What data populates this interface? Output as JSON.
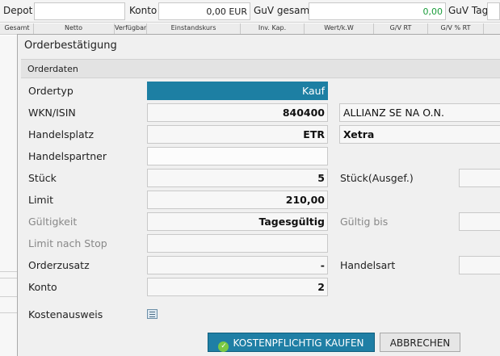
{
  "topbar": {
    "depot_label": "Depot",
    "konto_label": "Konto",
    "konto_value": "0,00 EUR",
    "guv_gesamt_label": "GuV gesamt",
    "guv_gesamt_value": "0,00",
    "guv_tag_label": "GuV Tag"
  },
  "columns": [
    "Gesamt",
    "Netto",
    "Verfügbar",
    "Einstandskurs",
    "Inv. Kap.",
    "Wert/k.W",
    "G/V RT",
    "G/V % RT"
  ],
  "dialog": {
    "title": "Orderbestätigung",
    "section": "Orderdaten",
    "fields": {
      "ordertyp": {
        "label": "Ordertyp",
        "value": "Kauf"
      },
      "wkn": {
        "label": "WKN/ISIN",
        "value": "840400",
        "name": "ALLIANZ SE NA O.N."
      },
      "handelsplatz": {
        "label": "Handelsplatz",
        "value": "ETR",
        "name": "Xetra"
      },
      "handelspartner": {
        "label": "Handelspartner",
        "value": ""
      },
      "stueck": {
        "label": "Stück",
        "value": "5",
        "ausgef_label": "Stück(Ausgef.)"
      },
      "limit": {
        "label": "Limit",
        "value": "210,00"
      },
      "gueltigkeit": {
        "label": "Gültigkeit",
        "value": "Tagesgültig",
        "bis_label": "Gültig bis"
      },
      "limit_stop": {
        "label": "Limit nach Stop",
        "value": ""
      },
      "orderzusatz": {
        "label": "Orderzusatz",
        "value": "-",
        "handelsart_label": "Handelsart"
      },
      "konto": {
        "label": "Konto",
        "value": "2"
      },
      "kostenausweis": {
        "label": "Kostenausweis"
      }
    },
    "buttons": {
      "buy": "KOSTENPFLICHTIG KAUFEN",
      "cancel": "ABBRECHEN"
    }
  },
  "icons": {
    "check": "check-circle-icon",
    "calculator": "calculator-icon"
  },
  "colors": {
    "accent": "#1f7fa5",
    "guv_value": "#1a9c3a"
  }
}
